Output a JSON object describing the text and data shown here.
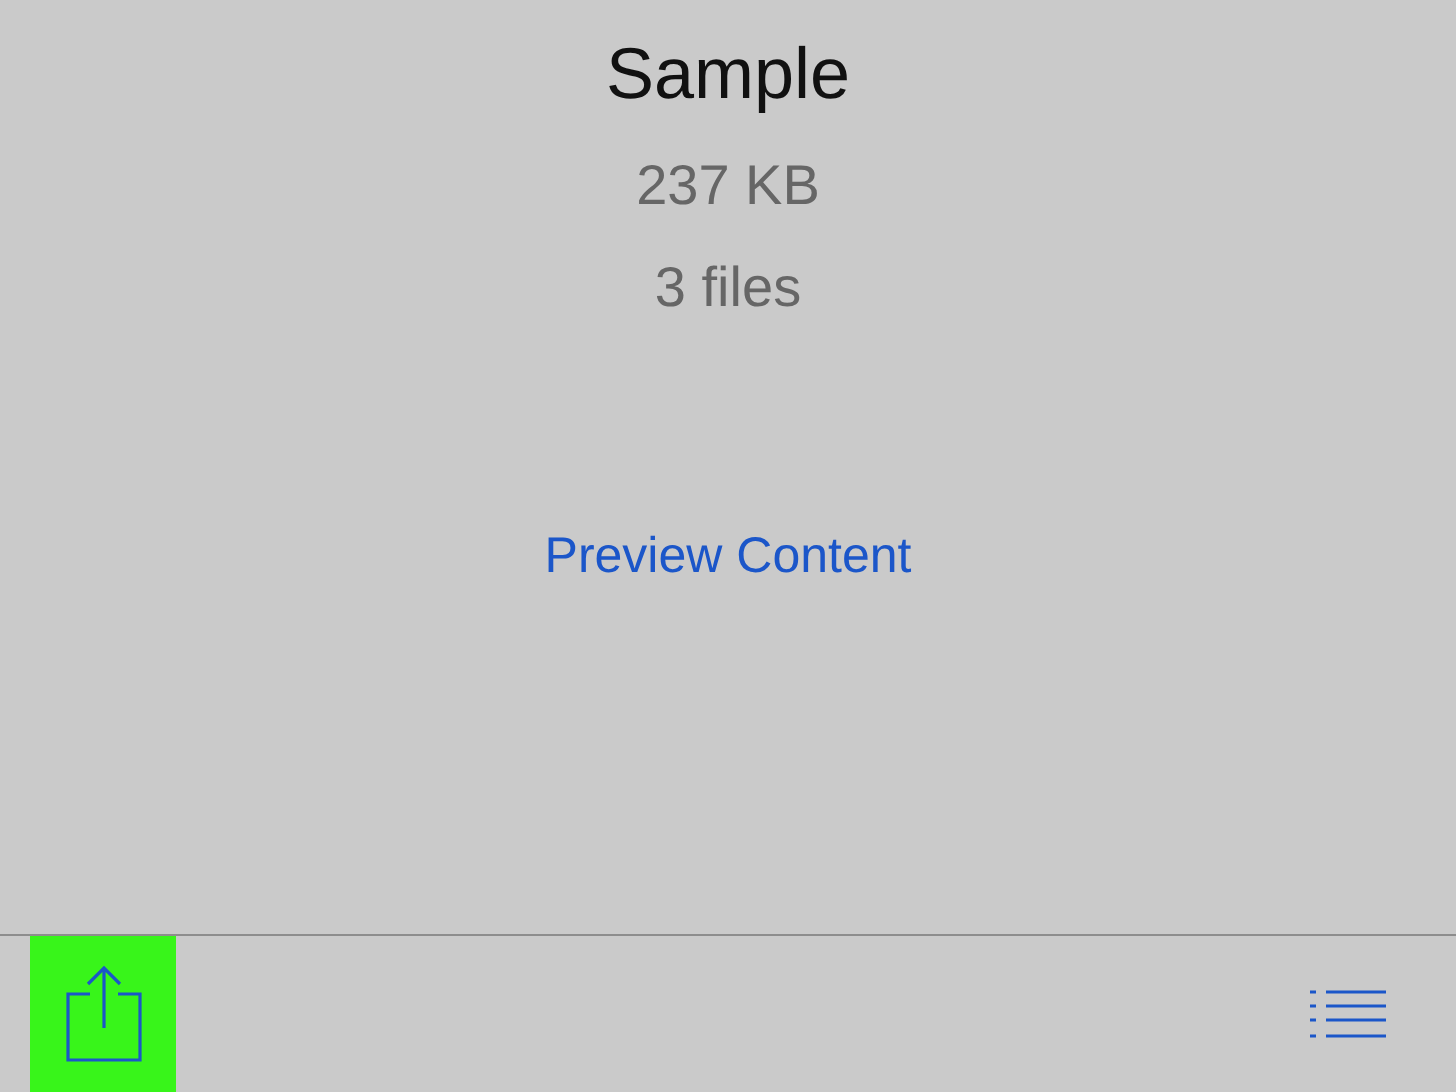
{
  "file": {
    "name": "Sample",
    "size": "237 KB",
    "count": "3 files"
  },
  "preview_link": "Preview Content",
  "toolbar": {
    "share_highlighted": true
  }
}
